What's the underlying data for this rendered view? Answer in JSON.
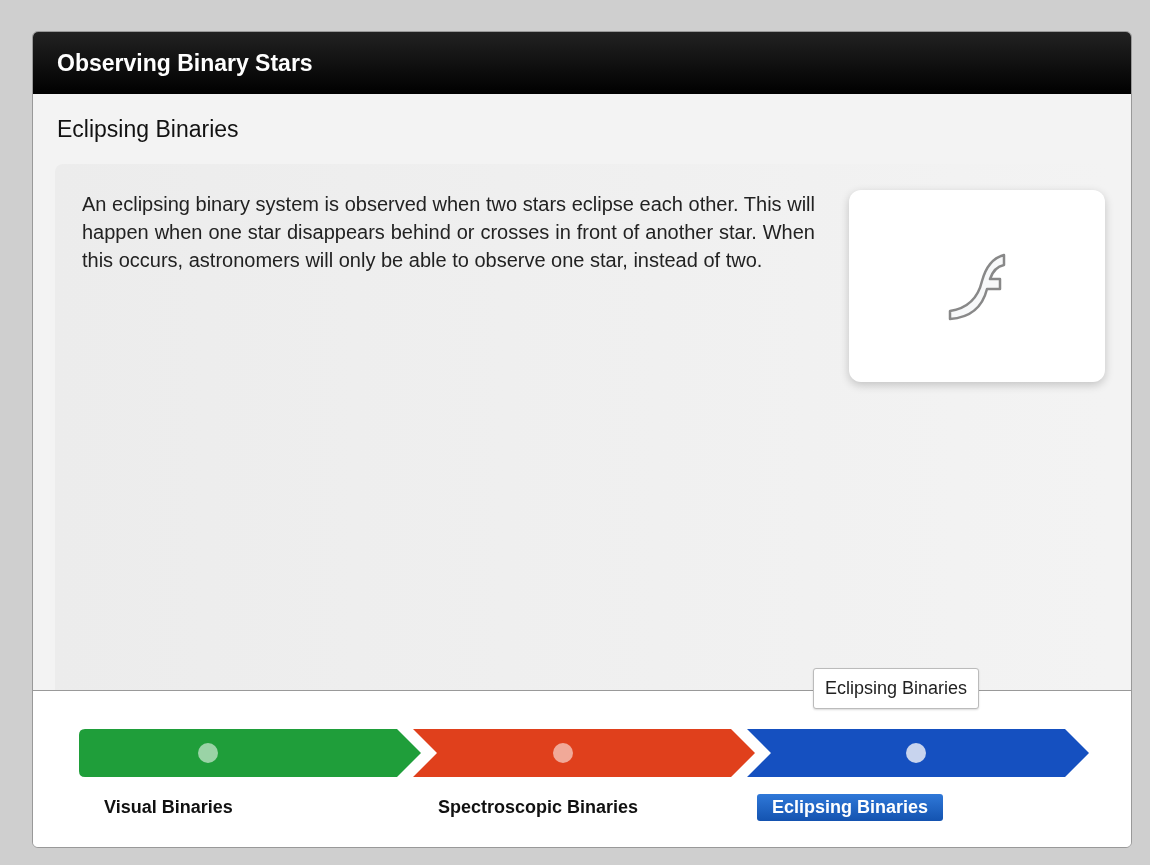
{
  "window": {
    "title": "Observing Binary Stars"
  },
  "section": {
    "title": "Eclipsing Binaries",
    "text": "An eclipsing binary system is observed when two stars eclipse each other. This will happen when one star disappears behind or crosses in front of another star. When this occurs, astronomers will only be able to observe one star, instead of two.",
    "media": {
      "kind": "flash"
    }
  },
  "tooltip": "Eclipsing Binaries",
  "steps": [
    {
      "label": "Visual Binaries",
      "color": "#1f9e3a",
      "selected": false
    },
    {
      "label": "Spectroscopic Binaries",
      "color": "#e0401c",
      "selected": false
    },
    {
      "label": "Eclipsing Binaries",
      "color": "#1550c0",
      "selected": true
    }
  ]
}
